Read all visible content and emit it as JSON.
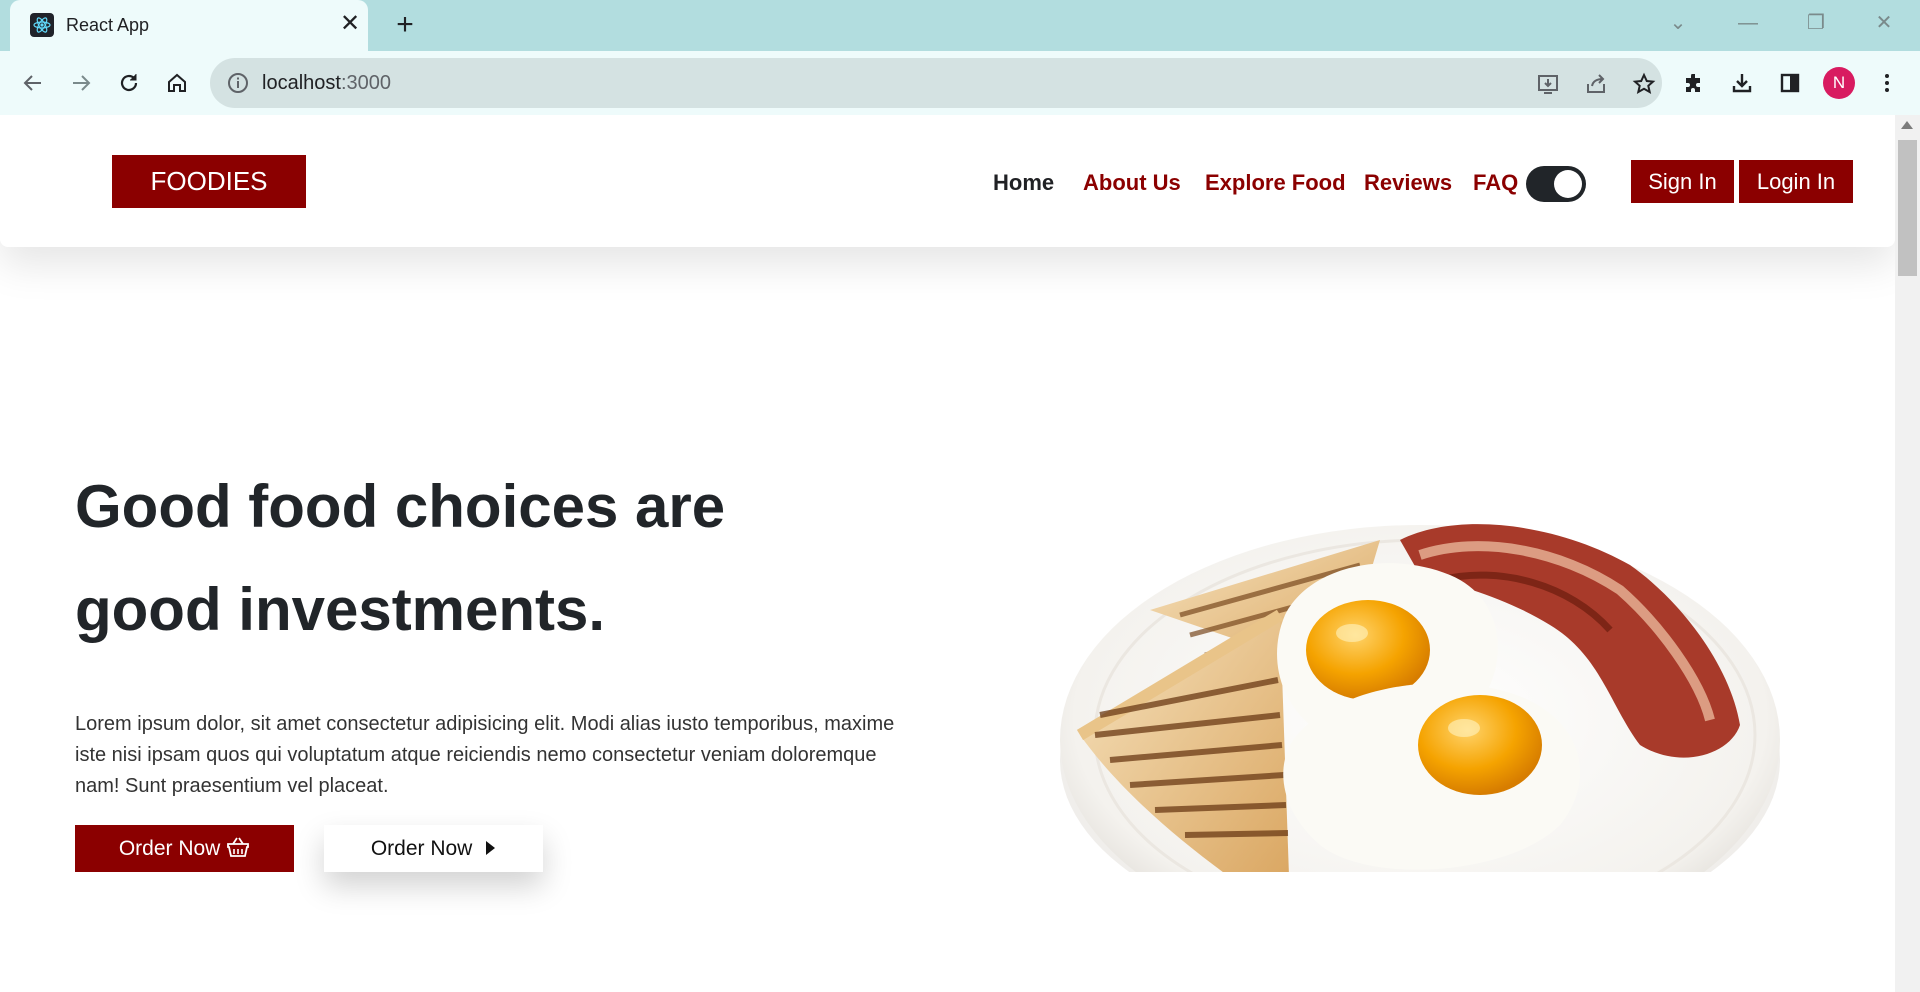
{
  "browser": {
    "tab_title": "React App",
    "url_host": "localhost",
    "url_port": ":3000",
    "profile_initial": "N"
  },
  "site": {
    "brand": "FOODIES",
    "nav": [
      {
        "label": "Home",
        "active": true
      },
      {
        "label": "About Us"
      },
      {
        "label": "Explore Food"
      },
      {
        "label": "Reviews"
      },
      {
        "label": "FAQ"
      }
    ],
    "theme_toggle_on": true,
    "sign_in": "Sign In",
    "login_in": "Login In"
  },
  "hero": {
    "title_line1": "Good food choices are",
    "title_line2": "good investments.",
    "text": "Lorem ipsum dolor, sit amet consectetur adipisicing elit. Modi alias iusto temporibus, maxime iste nisi ipsam quos qui voluptatum atque reiciendis nemo consectetur veniam doloremque nam! Sunt praesentium vel placeat.",
    "order_btn_1": "Order Now",
    "order_btn_2": "Order Now"
  },
  "colors": {
    "brand": "#8b0000",
    "tabbar": "#b2dddf",
    "toolbar": "#eefbfb",
    "omnibox": "#d4e2e2",
    "avatar": "#d81b60"
  },
  "icons": {
    "favicon": "react-icon",
    "order_btn_1_icon": "basket-icon",
    "order_btn_2_icon": "caret-right-icon"
  }
}
